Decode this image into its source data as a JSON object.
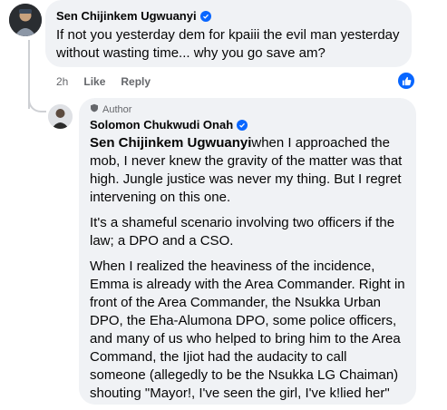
{
  "comment1": {
    "author": "Sen Chijinkem Ugwuanyi",
    "text": "If not you yesterday dem for kpaiii the evil man yesterday without wasting time... why you go save am?",
    "time": "2h",
    "like_label": "Like",
    "reply_label": "Reply",
    "reaction_icon": "like-icon"
  },
  "comment2": {
    "author_badge": "Author",
    "author": "Solomon Chukwudi Onah",
    "mention": "Sen Chijinkem Ugwuanyi",
    "p1": "when I approached the mob, I never knew the gravity of the matter was that high. Jungle justice was never my thing. But I regret intervening on this one.",
    "p2": "It's a shameful scenario involving two officers if the law; a DPO and a CSO.",
    "p3": "When I realized the heaviness of the incidence, Emma is already with the Area Commander. Right in front of the Area Commander, the Nsukka Urban DPO, the Eha-Alumona DPO, some police officers, and many of us who helped to bring him to the Area Command, the Ijiot had the audacity to call someone (allegedly to be the Nsukka LG Chaiman) shouting \"Mayor!, I've seen the girl, I've k!lied her\""
  },
  "colors": {
    "bubble": "#f0f2f5",
    "verified": "#0866ff",
    "meta": "#65676b"
  }
}
